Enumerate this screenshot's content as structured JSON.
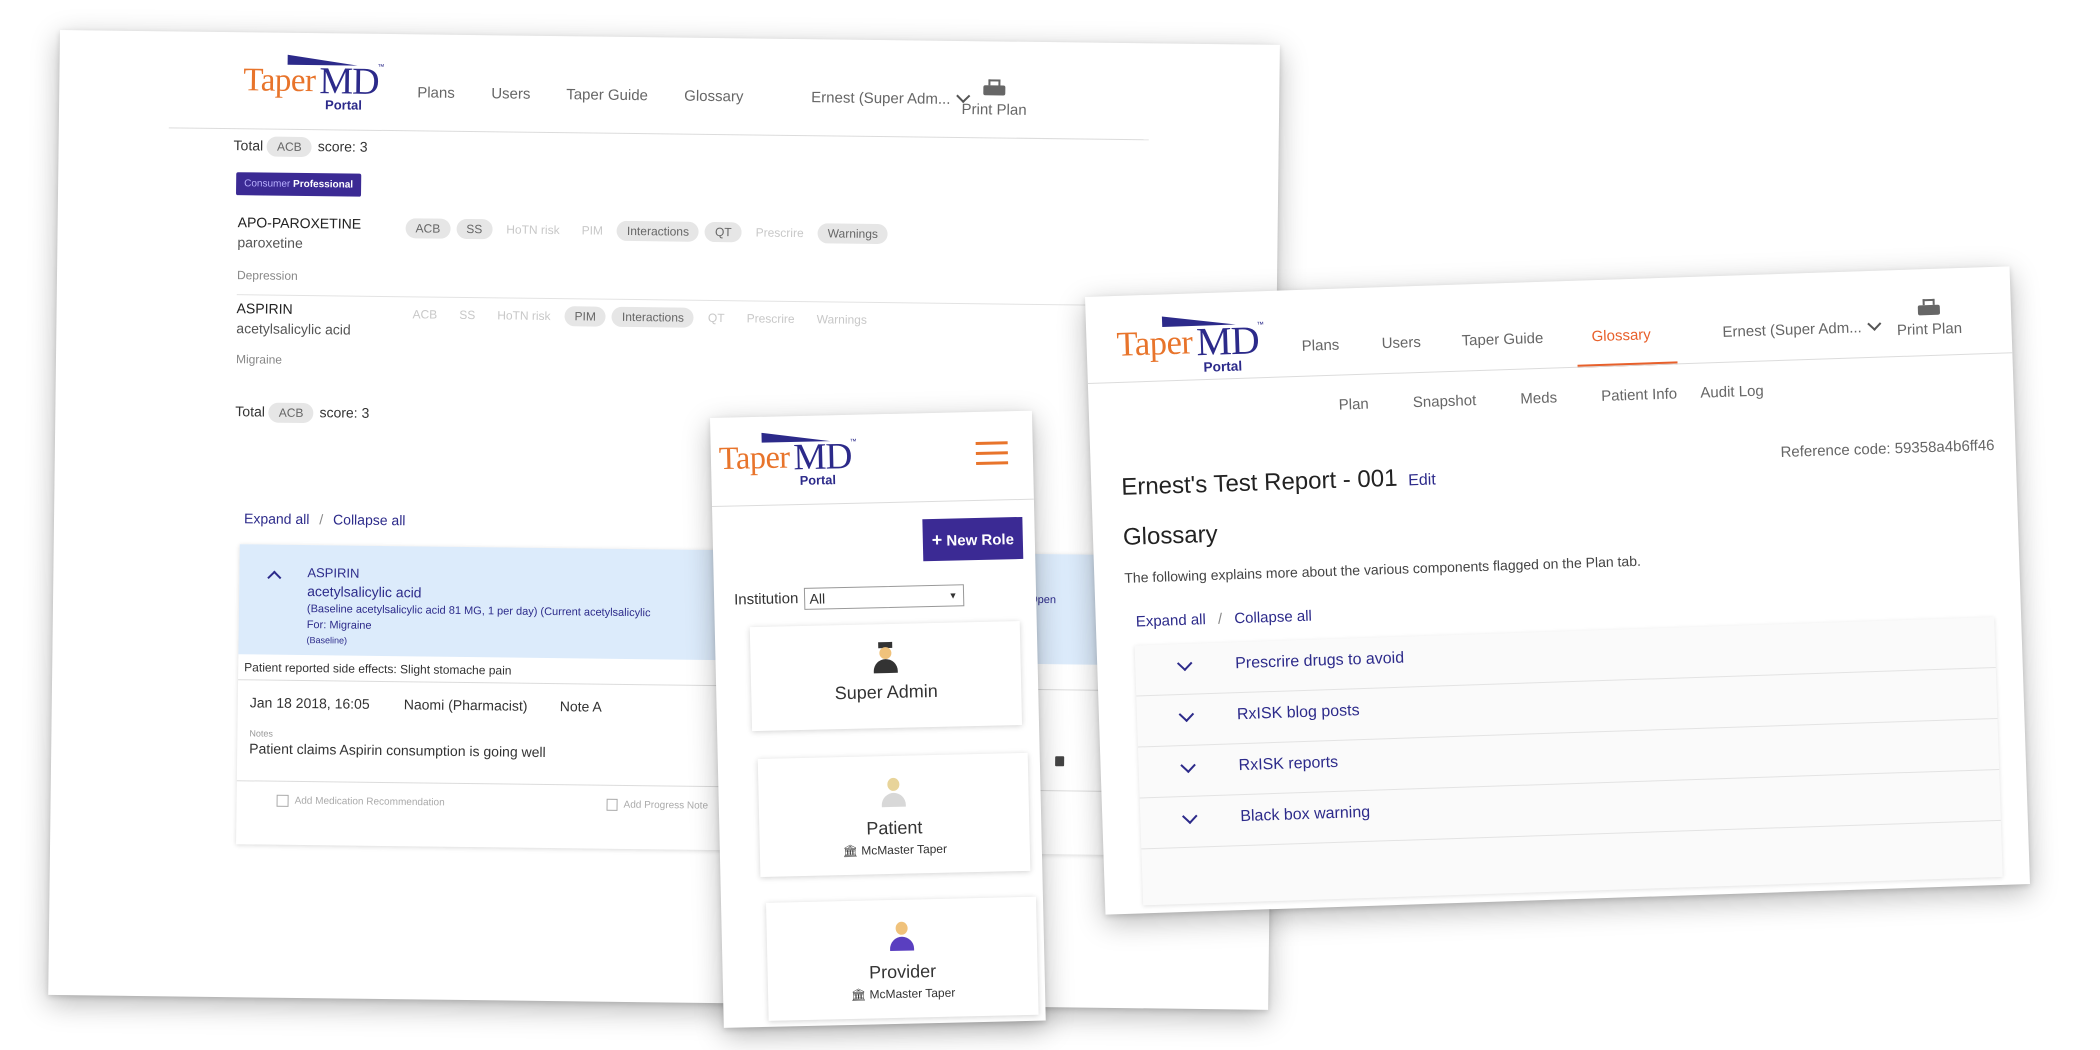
{
  "logo": {
    "taper": "Taper",
    "md": "MD",
    "portal": "Portal",
    "tm": "™"
  },
  "nav": {
    "plans": "Plans",
    "users": "Users",
    "taper_guide": "Taper Guide",
    "glossary": "Glossary",
    "user": "Ernest (Super Adm...",
    "print": "Print Plan"
  },
  "left": {
    "total_prefix": "Total",
    "acb": "ACB",
    "score": "score: 3",
    "toggle_consumer": "Consumer",
    "toggle_professional": "Professional",
    "tags": [
      "ACB",
      "SS",
      "HoTN risk",
      "PIM",
      "Interactions",
      "QT",
      "Prescrire",
      "Warnings"
    ],
    "meds": [
      {
        "brand": "APO-PAROXETINE",
        "generic": "paroxetine",
        "condition": "Depression"
      },
      {
        "brand": "ASPIRIN",
        "generic": "acetylsalicylic acid",
        "condition": "Migraine"
      }
    ],
    "expand_all": "Expand all",
    "sep": "/",
    "collapse_all": "Collapse all",
    "expanded": {
      "brand": "ASPIRIN",
      "generic": "acetylsalicylic acid",
      "detail": "(Baseline acetylsalicylic acid 81 MG, 1 per day) (Current acetylsalicylic",
      "for": "For: Migraine",
      "baseline": "(Baseline)",
      "open": "Open",
      "side_effects": "Patient reported side effects: Slight stomache pain",
      "date": "Jan 18 2018, 16:05",
      "author": "Naomi (Pharmacist)",
      "note_label": "Note A",
      "notes_label": "Notes",
      "note_text": "Patient claims Aspirin consumption is going well",
      "add_med_rec": "Add Medication Recommendation",
      "add_progress": "Add Progress Note"
    }
  },
  "mobile": {
    "new_role": "New Role",
    "institution_label": "Institution",
    "institution_value": "All",
    "roles": [
      {
        "name": "Super Admin",
        "inst": ""
      },
      {
        "name": "Patient",
        "inst": "McMaster Taper"
      },
      {
        "name": "Provider",
        "inst": "McMaster Taper"
      }
    ]
  },
  "right": {
    "subnav": [
      "Plan",
      "Snapshot",
      "Meds",
      "Patient Info",
      "Audit Log"
    ],
    "report_title": "Ernest's Test Report - 001",
    "edit": "Edit",
    "ref_code": "Reference code: 59358a4b6ff46",
    "section_title": "Glossary",
    "intro": "The following explains more about the various components flagged on the Plan tab.",
    "expand_all": "Expand all",
    "sep": "/",
    "collapse_all": "Collapse all",
    "items": [
      "Prescrire drugs to avoid",
      "RxISK blog posts",
      "RxISK reports",
      "Black box warning"
    ]
  }
}
